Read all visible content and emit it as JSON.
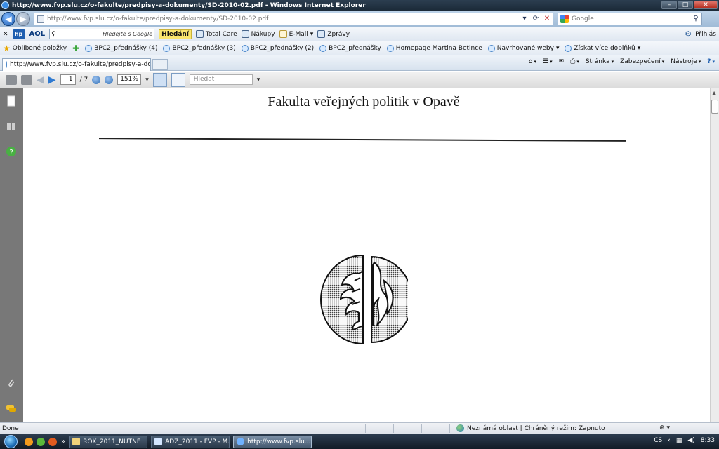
{
  "window": {
    "title": "http://www.fvp.slu.cz/o-fakulte/predpisy-a-dokumenty/SD-2010-02.pdf - Windows Internet Explorer",
    "minimize": "–",
    "maximize": "□",
    "close": "✕"
  },
  "address": {
    "url": "http://www.fvp.slu.cz/o-fakulte/predpisy-a-dokumenty/SD-2010-02.pdf",
    "search_placeholder": "Google"
  },
  "aol_toolbar": {
    "close": "✕",
    "hp": "hp",
    "aol": "AOL",
    "search_hint": "Hledejte s Google",
    "search_button": "Hledání",
    "items": [
      {
        "label": "Total Care"
      },
      {
        "label": "Nákupy"
      },
      {
        "label": "E-Mail"
      },
      {
        "label": "Zprávy"
      }
    ],
    "signin": "Přihlás"
  },
  "favorites": {
    "label": "Oblíbené položky",
    "items": [
      {
        "label": "BPC2_přednášky (4)"
      },
      {
        "label": "BPC2_přednášky (3)"
      },
      {
        "label": "BPC2_přednášky (2)"
      },
      {
        "label": "BPC2_přednášky"
      },
      {
        "label": "Homepage Martina Betince"
      },
      {
        "label": "Navrhované weby"
      },
      {
        "label": "Získat více doplňků"
      }
    ]
  },
  "tab": {
    "label": "http://www.fvp.slu.cz/o-fakulte/predpisy-a-doku..."
  },
  "command_bar": {
    "page": "Stránka",
    "security": "Zabezpečení",
    "tools": "Nástroje"
  },
  "pdf_toolbar": {
    "page_current": "1",
    "page_total": "/ 7",
    "zoom": "151%",
    "find_placeholder": "Hledat"
  },
  "document": {
    "title": "Fakulta veřejných politik v Opavě"
  },
  "status": {
    "text": "Done",
    "zone": "Neznámá oblast | Chráněný režim: Zapnuto",
    "zoom_control": "⊕ ▾"
  },
  "taskbar": {
    "tasks": [
      {
        "label": "ROK_2011_NUTNE"
      },
      {
        "label": "ADZ_2011 - FVP - M..."
      },
      {
        "label": "http://www.fvp.slu...."
      }
    ],
    "language": "CS",
    "time": "8:33"
  },
  "colors": {
    "titlebar": "#1b2a38",
    "accent": "#2f7ad1",
    "navpane": "#787878",
    "taskbar": "#121b26"
  }
}
